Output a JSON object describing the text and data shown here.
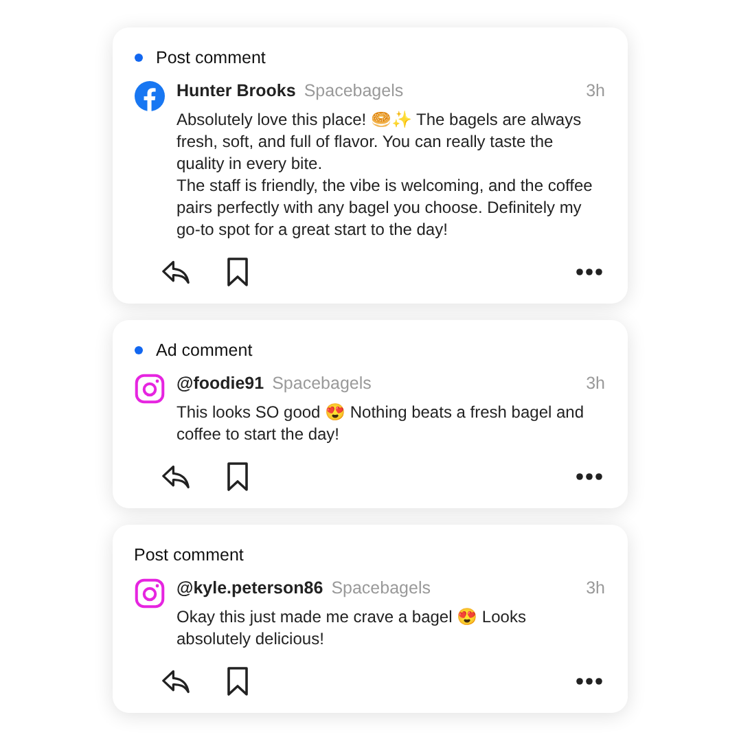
{
  "comments": [
    {
      "label": "Post comment",
      "unread": true,
      "kind": "facebook",
      "author": "Hunter Brooks",
      "page": "Spacebagels",
      "time": "3h",
      "text": "Absolutely love this place! 🥯✨ The bagels are always fresh, soft, and full of flavor. You can really taste the quality in every bite.\nThe staff is friendly, the vibe is welcoming, and the coffee pairs perfectly with any bagel you choose. Definitely my go-to spot for a great start to the day!"
    },
    {
      "label": "Ad comment",
      "unread": true,
      "kind": "instagram",
      "author": "@foodie91",
      "page": "Spacebagels",
      "time": "3h",
      "text": "This looks SO good 😍 Nothing beats a fresh bagel and coffee to start the day!"
    },
    {
      "label": "Post comment",
      "unread": false,
      "kind": "instagram",
      "author": "@kyle.peterson86",
      "page": "Spacebagels",
      "time": "3h",
      "text": "Okay this just made me crave a bagel 😍 Looks absolutely delicious!"
    }
  ]
}
